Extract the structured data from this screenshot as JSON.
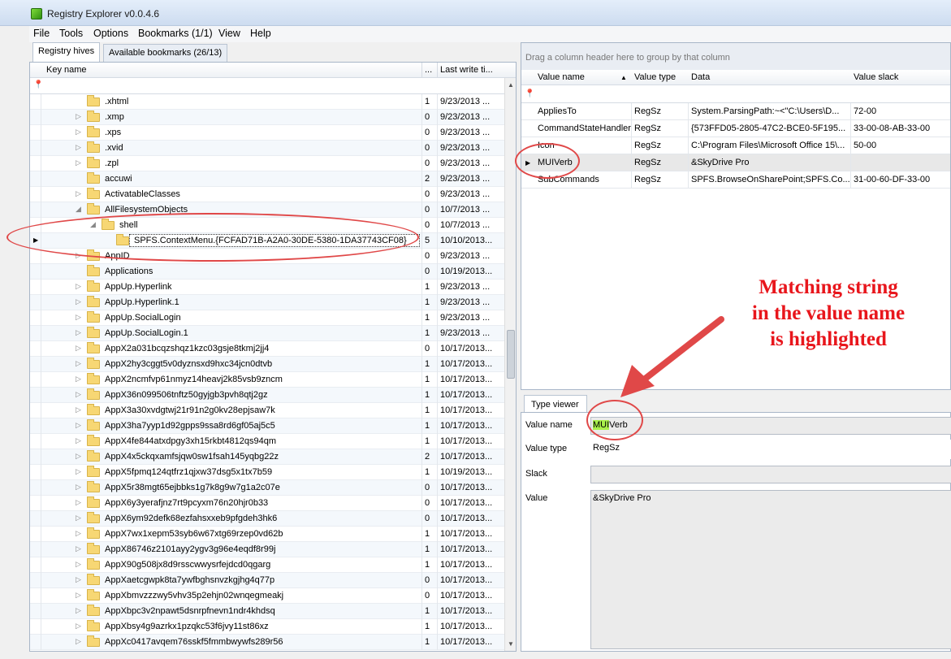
{
  "window": {
    "title": "Registry Explorer v0.0.4.6"
  },
  "menu": [
    "File",
    "Tools",
    "Options",
    "Bookmarks (1/1)",
    "View",
    "Help"
  ],
  "left_tabs": [
    "Registry hives",
    "Available bookmarks (26/13)"
  ],
  "tree": {
    "columns": {
      "key_name": "Key name",
      "count": "...",
      "last_write": "Last write ti..."
    },
    "rows": [
      {
        "indent": 1,
        "expander": "",
        "name": ".xhtml",
        "count": "1",
        "date": "9/23/2013 ..."
      },
      {
        "indent": 1,
        "expander": "▷",
        "name": ".xmp",
        "count": "0",
        "date": "9/23/2013 ..."
      },
      {
        "indent": 1,
        "expander": "▷",
        "name": ".xps",
        "count": "0",
        "date": "9/23/2013 ..."
      },
      {
        "indent": 1,
        "expander": "▷",
        "name": ".xvid",
        "count": "0",
        "date": "9/23/2013 ..."
      },
      {
        "indent": 1,
        "expander": "▷",
        "name": ".zpl",
        "count": "0",
        "date": "9/23/2013 ..."
      },
      {
        "indent": 1,
        "expander": "",
        "name": "accuwi",
        "count": "2",
        "date": "9/23/2013 ..."
      },
      {
        "indent": 1,
        "expander": "▷",
        "name": "ActivatableClasses",
        "count": "0",
        "date": "9/23/2013 ..."
      },
      {
        "indent": 1,
        "expander": "◢",
        "name": "AllFilesystemObjects",
        "count": "0",
        "date": "10/7/2013 ..."
      },
      {
        "indent": 2,
        "expander": "◢",
        "name": "shell",
        "count": "0",
        "date": "10/7/2013 ..."
      },
      {
        "indent": 3,
        "expander": "",
        "name": "SPFS.ContextMenu.{FCFAD71B-A2A0-30DE-5380-1DA37743CF08}",
        "count": "5",
        "date": "10/10/2013...",
        "selected": true
      },
      {
        "indent": 1,
        "expander": "▷",
        "name": "AppID",
        "count": "0",
        "date": "9/23/2013 ..."
      },
      {
        "indent": 1,
        "expander": "",
        "name": "Applications",
        "count": "0",
        "date": "10/19/2013..."
      },
      {
        "indent": 1,
        "expander": "▷",
        "name": "AppUp.Hyperlink",
        "count": "1",
        "date": "9/23/2013 ..."
      },
      {
        "indent": 1,
        "expander": "▷",
        "name": "AppUp.Hyperlink.1",
        "count": "1",
        "date": "9/23/2013 ..."
      },
      {
        "indent": 1,
        "expander": "▷",
        "name": "AppUp.SocialLogin",
        "count": "1",
        "date": "9/23/2013 ..."
      },
      {
        "indent": 1,
        "expander": "▷",
        "name": "AppUp.SocialLogin.1",
        "count": "1",
        "date": "9/23/2013 ..."
      },
      {
        "indent": 1,
        "expander": "▷",
        "name": "AppX2a031bcqzshqz1kzc03gsje8tkmj2jj4",
        "count": "0",
        "date": "10/17/2013..."
      },
      {
        "indent": 1,
        "expander": "▷",
        "name": "AppX2hy3cggt5v0dyznsxd9hxc34jcn0dtvb",
        "count": "1",
        "date": "10/17/2013..."
      },
      {
        "indent": 1,
        "expander": "▷",
        "name": "AppX2ncmfvp61nmyz14heavj2k85vsb9zncm",
        "count": "1",
        "date": "10/17/2013..."
      },
      {
        "indent": 1,
        "expander": "▷",
        "name": "AppX36n099506tnftz50gyjgb3pvh8qtj2gz",
        "count": "1",
        "date": "10/17/2013..."
      },
      {
        "indent": 1,
        "expander": "▷",
        "name": "AppX3a30xvdgtwj21r91n2g0kv28epjsaw7k",
        "count": "1",
        "date": "10/17/2013..."
      },
      {
        "indent": 1,
        "expander": "▷",
        "name": "AppX3ha7yyp1d92gpps9ssa8rd6gf05aj5c5",
        "count": "1",
        "date": "10/17/2013..."
      },
      {
        "indent": 1,
        "expander": "▷",
        "name": "AppX4fe844atxdpgy3xh15rkbt4812qs94qm",
        "count": "1",
        "date": "10/17/2013..."
      },
      {
        "indent": 1,
        "expander": "▷",
        "name": "AppX4x5ckqxamfsjqw0sw1fsah145yqbg22z",
        "count": "2",
        "date": "10/17/2013..."
      },
      {
        "indent": 1,
        "expander": "▷",
        "name": "AppX5fpmq124qtfrz1qjxw37dsg5x1tx7b59",
        "count": "1",
        "date": "10/19/2013..."
      },
      {
        "indent": 1,
        "expander": "▷",
        "name": "AppX5r38mgt65ejbbks1g7k8g9w7g1a2c07e",
        "count": "0",
        "date": "10/17/2013..."
      },
      {
        "indent": 1,
        "expander": "▷",
        "name": "AppX6y3yerafjnz7rt9pcyxm76n20hjr0b33",
        "count": "0",
        "date": "10/17/2013..."
      },
      {
        "indent": 1,
        "expander": "▷",
        "name": "AppX6ym92defk68ezfahsxxeb9pfgdeh3hk6",
        "count": "0",
        "date": "10/17/2013..."
      },
      {
        "indent": 1,
        "expander": "▷",
        "name": "AppX7wx1xepm53syb6w67xtg69rzep0vd62b",
        "count": "1",
        "date": "10/17/2013..."
      },
      {
        "indent": 1,
        "expander": "▷",
        "name": "AppX86746z2101ayy2ygv3g96e4eqdf8r99j",
        "count": "1",
        "date": "10/17/2013..."
      },
      {
        "indent": 1,
        "expander": "▷",
        "name": "AppX90g508jx8d9rsscwwysrfejdcd0qgarg",
        "count": "1",
        "date": "10/17/2013..."
      },
      {
        "indent": 1,
        "expander": "▷",
        "name": "AppXaetcgwpk8ta7ywfbghsnvzkgjhg4q77p",
        "count": "0",
        "date": "10/17/2013..."
      },
      {
        "indent": 1,
        "expander": "▷",
        "name": "AppXbmvzzzwy5vhv35p2ehjn02wnqegmeakj",
        "count": "0",
        "date": "10/17/2013..."
      },
      {
        "indent": 1,
        "expander": "▷",
        "name": "AppXbpc3v2npawt5dsnrpfnevn1ndr4khdsq",
        "count": "1",
        "date": "10/17/2013..."
      },
      {
        "indent": 1,
        "expander": "▷",
        "name": "AppXbsy4g9azrkx1pzqkc53f6jvy11st86xz",
        "count": "1",
        "date": "10/17/2013..."
      },
      {
        "indent": 1,
        "expander": "▷",
        "name": "AppXc0417avqem76sskf5fmmbwywfs289r56",
        "count": "1",
        "date": "10/17/2013..."
      }
    ]
  },
  "values_grid": {
    "group_hint": "Drag a column header here to group by that column",
    "columns": [
      "Value name",
      "Value type",
      "Data",
      "Value slack"
    ],
    "rows": [
      {
        "name": "AppliesTo",
        "type": "RegSz",
        "data": "System.ParsingPath:~<\"C:\\Users\\D...",
        "slack": "72-00"
      },
      {
        "name": "CommandStateHandler",
        "type": "RegSz",
        "data": "{573FFD05-2805-47C2-BCE0-5F195...",
        "slack": "33-00-08-AB-33-00"
      },
      {
        "name": "Icon",
        "type": "RegSz",
        "data": "C:\\Program Files\\Microsoft Office 15\\...",
        "slack": "50-00"
      },
      {
        "name": "MUIVerb",
        "type": "RegSz",
        "data": "&SkyDrive Pro",
        "slack": "",
        "selected": true
      },
      {
        "name": "SubCommands",
        "type": "RegSz",
        "data": "SPFS.BrowseOnSharePoint;SPFS.Co...",
        "slack": "31-00-60-DF-33-00"
      }
    ]
  },
  "type_viewer": {
    "tab": "Type viewer",
    "value_name_label": "Value name",
    "value_name_match": "MUI",
    "value_name_rest": "Verb",
    "value_type_label": "Value type",
    "value_type": "RegSz",
    "slack_label": "Slack",
    "slack": "",
    "value_label": "Value",
    "value": "&SkyDrive Pro"
  },
  "annotation": {
    "line1": "Matching string",
    "line2": "in the value name",
    "line3": "is highlighted",
    "color": "#e8161c"
  }
}
